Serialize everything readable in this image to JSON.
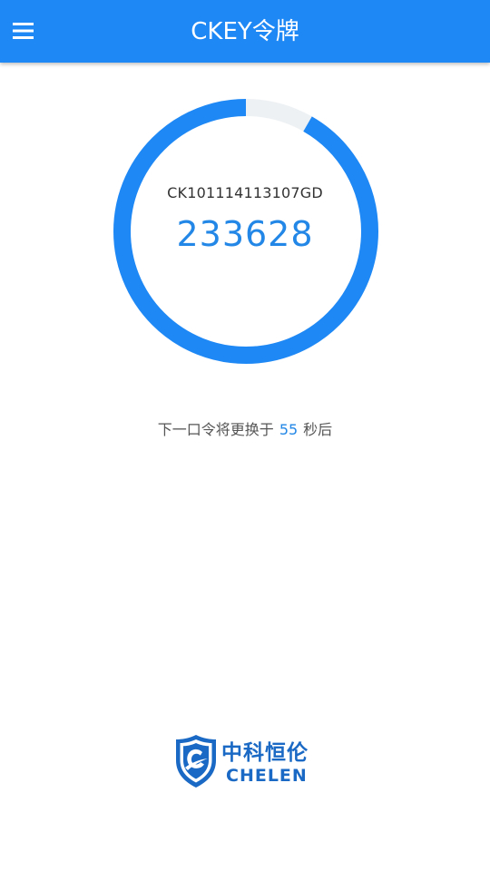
{
  "app_bar": {
    "title": "CKEY令牌",
    "menu_icon": "hamburger-menu-icon",
    "color": "#1e88f5"
  },
  "token": {
    "serial": "CK101114113107GD",
    "code": "233628",
    "progress_remaining_fraction": 0.917,
    "ring_color": "#1e88f5",
    "ring_track_color": "#eef1f4"
  },
  "countdown": {
    "prefix": "下一口令将更换于",
    "seconds": "55",
    "suffix": "秒后"
  },
  "brand": {
    "logo_icon": "shield-c-logo-icon",
    "name_cn": "中科恒伦",
    "name_en": "CHELEN",
    "color": "#1a69c4"
  }
}
